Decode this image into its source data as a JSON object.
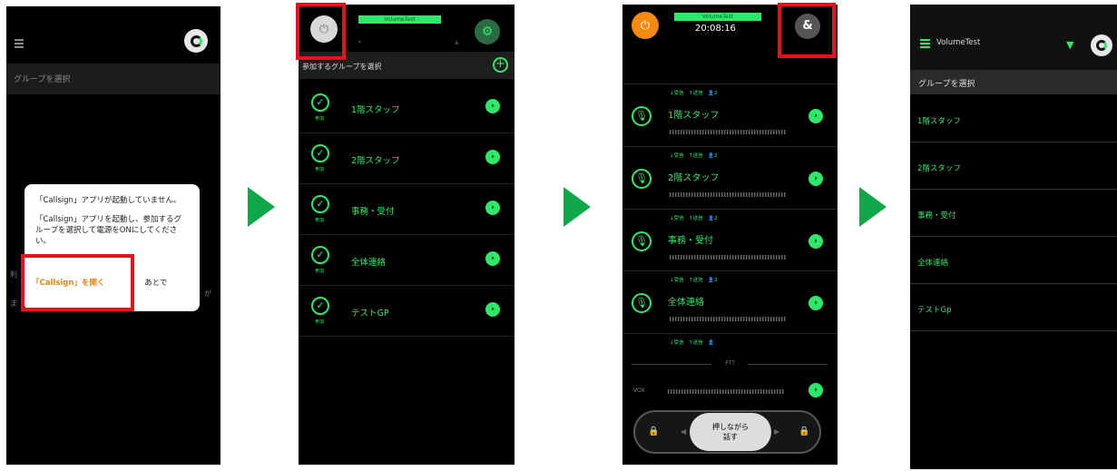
{
  "panel1": {
    "select_group": "グループを選択",
    "dialog_line1": "「Callsign」アプリが起動していません。",
    "dialog_line2": "「Callsign」アプリを起動し、参加するグループを選択して電源をONにしてください。",
    "open_button": "「Callsign」を開く",
    "later_button": "あとで",
    "partial_text_1": "利",
    "partial_text_2": "ま",
    "partial_text_3": "が"
  },
  "panel2": {
    "title": "VolumeTest",
    "header": "参加するグループを選択",
    "join_label": "参加",
    "groups": [
      "1階スタッフ",
      "2階スタッフ",
      "事務・受付",
      "全体連絡",
      "テストGP"
    ]
  },
  "panel3": {
    "title": "VolumeTest",
    "time": "20:08:16",
    "amp_label": "&",
    "status": "↓受信　↑送信　👤2",
    "status_last": "↓受信　↑送信　👤",
    "groups": [
      "1階スタッフ",
      "2階スタッフ",
      "事務・受付",
      "全体連絡"
    ],
    "ptt_label": "PTT",
    "vox_label": "VOX",
    "ptt_button_line1": "押しながら",
    "ptt_button_line2": "話す"
  },
  "panel4": {
    "app_title": "VolumeTest",
    "select_group": "グループを選択",
    "groups": [
      "1階スタッフ",
      "2階スタッフ",
      "事務・受付",
      "全体連絡",
      "テストGp"
    ]
  },
  "colors": {
    "accent": "#2ee86a",
    "arrow": "#10a64a",
    "highlight": "#e8101e",
    "orange": "#e98216"
  }
}
